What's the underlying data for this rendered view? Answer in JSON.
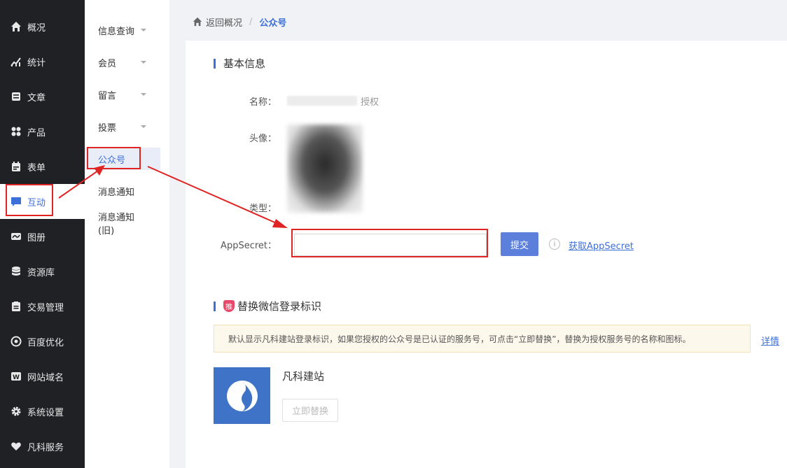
{
  "sidebar": {
    "items": [
      {
        "label": "概况",
        "icon": "home-icon"
      },
      {
        "label": "统计",
        "icon": "chart-icon"
      },
      {
        "label": "文章",
        "icon": "article-icon"
      },
      {
        "label": "产品",
        "icon": "grid-icon"
      },
      {
        "label": "表单",
        "icon": "calendar-icon"
      },
      {
        "label": "互动",
        "icon": "chat-icon"
      },
      {
        "label": "图册",
        "icon": "album-icon"
      },
      {
        "label": "资源库",
        "icon": "database-icon"
      },
      {
        "label": "交易管理",
        "icon": "clipboard-icon"
      },
      {
        "label": "百度优化",
        "icon": "target-icon"
      },
      {
        "label": "网站域名",
        "icon": "domain-icon"
      },
      {
        "label": "系统设置",
        "icon": "gear-icon"
      },
      {
        "label": "凡科服务",
        "icon": "heart-icon"
      }
    ],
    "active": "互动"
  },
  "submenu": {
    "items": [
      {
        "label": "信息查询"
      },
      {
        "label": "会员"
      },
      {
        "label": "留言"
      },
      {
        "label": "投票"
      },
      {
        "label": "公众号"
      },
      {
        "label": "消息通知"
      },
      {
        "label": "消息通知(旧)"
      }
    ],
    "active": "公众号"
  },
  "breadcrumb": {
    "back": "返回概况",
    "separator": "/",
    "current": "公众号"
  },
  "basic_info": {
    "title": "基本信息",
    "name_label": "名称：",
    "name_suffix": "授权",
    "avatar_label": "头像：",
    "type_label": "类型：",
    "appsecret_label": "AppSecret：",
    "appsecret_value": "",
    "submit_label": "提交",
    "info_icon": "i",
    "get_link": "获取AppSecret"
  },
  "replace_login": {
    "badge": "推",
    "title": "替换微信登录标识",
    "notice": "默认显示凡科建站登录标识，如果您授权的公众号是已认证的服务号，可点击“立即替换”，替换为授权服务号的名称和图标。",
    "detail_link": "详情",
    "brand_name": "凡科建站",
    "replace_button": "立即替换"
  },
  "colors": {
    "accent": "#3d6fd9",
    "sidebar_bg": "#1f2124",
    "annotation": "#e02424",
    "brand_logo_bg": "#3f73c8"
  }
}
